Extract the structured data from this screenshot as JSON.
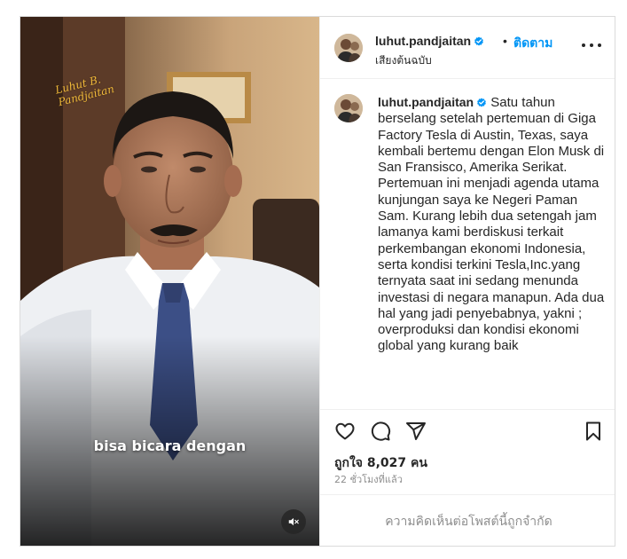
{
  "header": {
    "username": "luhut.pandjaitan",
    "separator": "•",
    "follow_label": "ติดตาม",
    "audio_label": "เสียงต้นฉบับ"
  },
  "media": {
    "watermark": "Luhut B. Pandjaitan",
    "subtitle": "bisa bicara dengan"
  },
  "caption": {
    "username": "luhut.pandjaitan",
    "text": "Satu tahun berselang setelah pertemuan di Giga Factory Tesla di Austin, Texas, saya kembali bertemu dengan Elon Musk di San Fransisco, Amerika Serikat. Pertemuan ini menjadi agenda utama kunjungan saya ke Negeri Paman Sam. Kurang lebih dua setengah jam lamanya kami berdiskusi terkait perkembangan ekonomi Indonesia, serta kondisi terkini Tesla,Inc.yang ternyata saat ini sedang menunda investasi di negara manapun. Ada dua hal yang jadi penyebabnya, yakni ; overproduksi dan kondisi ekonomi global yang kurang baik"
  },
  "stats": {
    "likes": "ถูกใจ 8,027 คน",
    "timestamp": "22 ชั่วโมงที่แล้ว"
  },
  "comments": {
    "limited_notice": "ความคิดเห็นต่อโพสต์นี้ถูกจำกัด"
  },
  "icons": {
    "like": "heart-icon",
    "comment": "comment-icon",
    "share": "send-icon",
    "save": "bookmark-icon",
    "more": "more-options-icon",
    "mute": "muted-speaker-icon",
    "verified": "verified-badge-icon"
  },
  "colors": {
    "follow": "#0095f6",
    "verified": "#0095f6",
    "muted_text": "#8e8e8e",
    "watermark": "#f0b93a"
  }
}
